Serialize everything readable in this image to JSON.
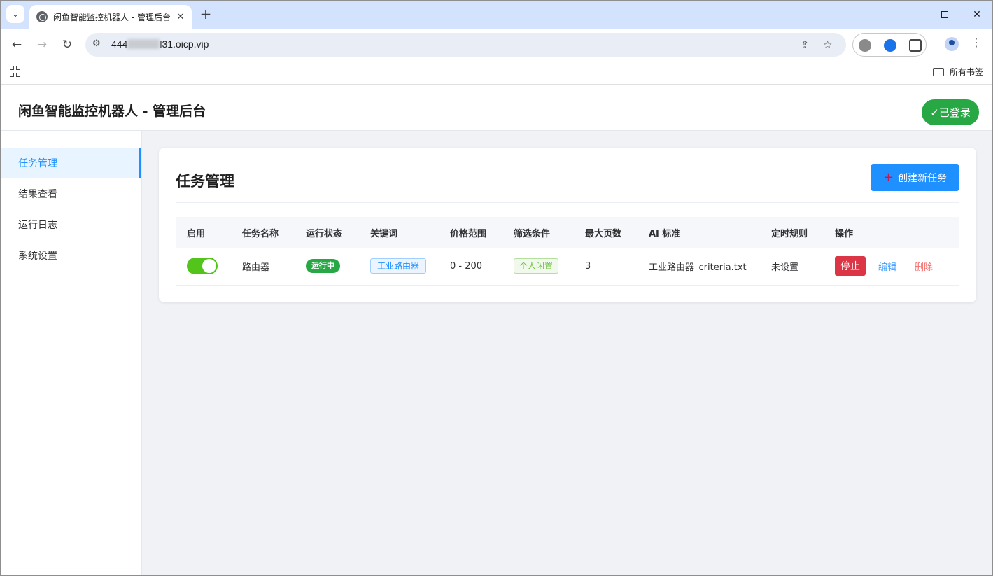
{
  "browser": {
    "tab_title": "闲鱼智能监控机器人 - 管理后台",
    "url_prefix": "444",
    "url_suffix": "l31.oicp.vip",
    "bookmarks_folder": "所有书签"
  },
  "header": {
    "title": "闲鱼智能监控机器人 - 管理后台",
    "login_status": "✓已登录"
  },
  "sidebar": {
    "items": [
      {
        "label": "任务管理",
        "active": true
      },
      {
        "label": "结果查看",
        "active": false
      },
      {
        "label": "运行日志",
        "active": false
      },
      {
        "label": "系统设置",
        "active": false
      }
    ]
  },
  "main": {
    "title": "任务管理",
    "create_button": "创建新任务",
    "columns": [
      "启用",
      "任务名称",
      "运行状态",
      "关键词",
      "价格范围",
      "筛选条件",
      "最大页数",
      "AI 标准",
      "定时规则",
      "操作"
    ],
    "rows": [
      {
        "enabled": true,
        "name": "路由器",
        "status": "运行中",
        "keyword": "工业路由器",
        "price_range": "0 - 200",
        "filter": "个人闲置",
        "max_pages": "3",
        "ai_standard": "工业路由器_criteria.txt",
        "schedule": "未设置",
        "actions": {
          "stop": "停止",
          "edit": "编辑",
          "delete": "删除"
        }
      }
    ]
  },
  "colors": {
    "accent": "#1e90ff",
    "success": "#28a745",
    "danger": "#dc3545",
    "toggle_on": "#52c41a"
  }
}
